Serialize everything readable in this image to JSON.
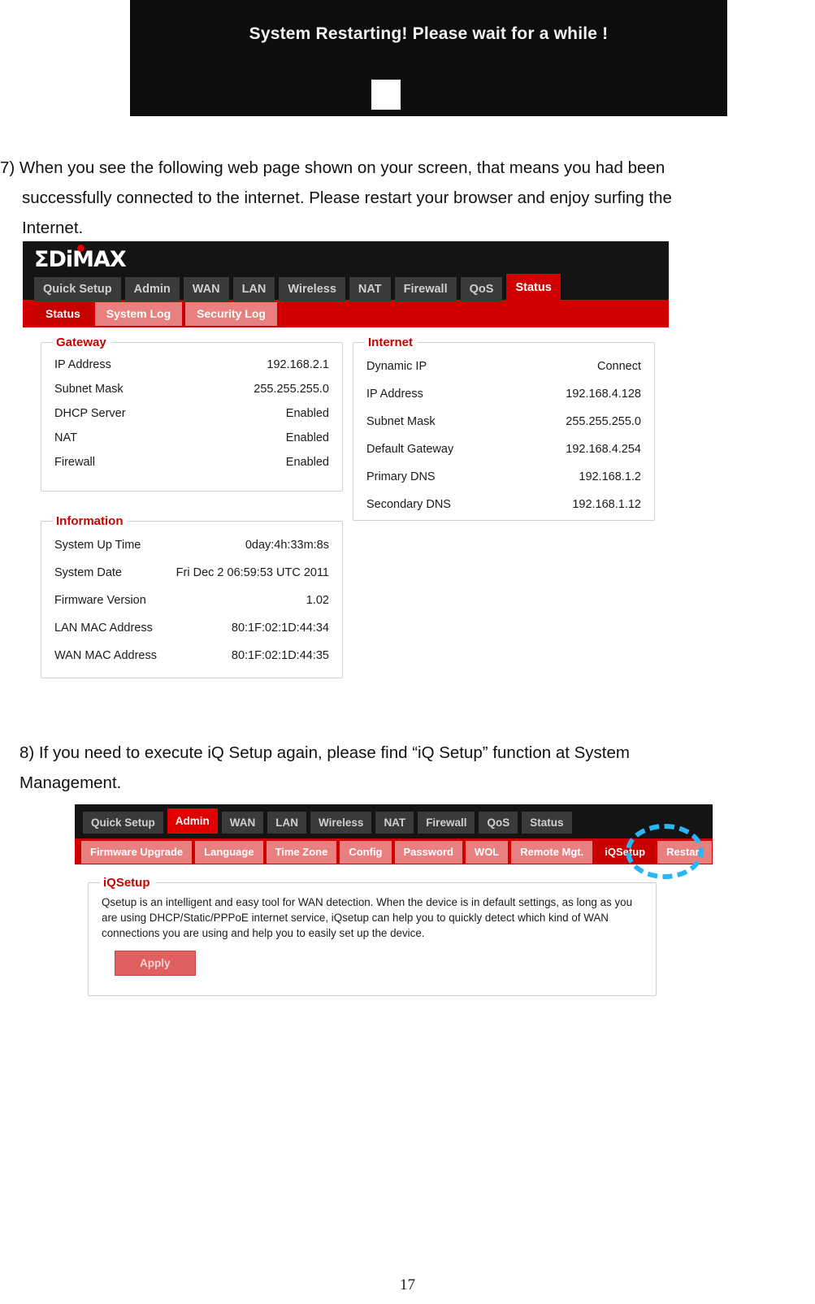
{
  "restart_banner": {
    "message": "System Restarting! Please wait for a while !",
    "progress_label": ""
  },
  "steps": {
    "step7": {
      "number": "7)",
      "line1": "7) When you see the following web page shown on your screen, that means you had been",
      "line2": "successfully connected to the internet. Please restart your browser and enjoy surfing the",
      "line3": "Internet."
    },
    "step8": {
      "line1": "8) If you need to execute iQ Setup again, please find “iQ Setup” function at System",
      "line2": "Management."
    }
  },
  "router_status": {
    "logo": "ΣDiMAX",
    "nav_tabs": [
      {
        "label": "Quick Setup",
        "active": false
      },
      {
        "label": "Admin",
        "active": false
      },
      {
        "label": "WAN",
        "active": false
      },
      {
        "label": "LAN",
        "active": false
      },
      {
        "label": "Wireless",
        "active": false
      },
      {
        "label": "NAT",
        "active": false
      },
      {
        "label": "Firewall",
        "active": false
      },
      {
        "label": "QoS",
        "active": false
      },
      {
        "label": "Status",
        "active": true
      }
    ],
    "sub_tabs": [
      {
        "label": "Status",
        "active": true
      },
      {
        "label": "System Log",
        "active": false
      },
      {
        "label": "Security Log",
        "active": false
      }
    ],
    "panels": {
      "gateway": {
        "title": "Gateway",
        "rows": [
          {
            "key": "IP Address",
            "value": "192.168.2.1"
          },
          {
            "key": "Subnet Mask",
            "value": "255.255.255.0"
          },
          {
            "key": "DHCP Server",
            "value": "Enabled"
          },
          {
            "key": "NAT",
            "value": "Enabled"
          },
          {
            "key": "Firewall",
            "value": "Enabled"
          }
        ]
      },
      "internet": {
        "title": "Internet",
        "rows": [
          {
            "key": "Dynamic IP",
            "value": "Connect"
          },
          {
            "key": "IP Address",
            "value": "192.168.4.128"
          },
          {
            "key": "Subnet Mask",
            "value": "255.255.255.0"
          },
          {
            "key": "Default Gateway",
            "value": "192.168.4.254"
          },
          {
            "key": "Primary DNS",
            "value": "192.168.1.2"
          },
          {
            "key": "Secondary DNS",
            "value": "192.168.1.12"
          }
        ]
      },
      "information": {
        "title": "Information",
        "rows": [
          {
            "key": "System Up Time",
            "value": "0day:4h:33m:8s"
          },
          {
            "key": "System Date",
            "value": "Fri Dec 2 06:59:53 UTC 2011"
          },
          {
            "key": "Firmware Version",
            "value": "1.02"
          },
          {
            "key": "LAN MAC Address",
            "value": "80:1F:02:1D:44:34"
          },
          {
            "key": "WAN MAC Address",
            "value": "80:1F:02:1D:44:35"
          }
        ]
      }
    }
  },
  "router_admin": {
    "nav_tabs": [
      {
        "label": "Quick Setup",
        "active": false
      },
      {
        "label": "Admin",
        "active": true
      },
      {
        "label": "WAN",
        "active": false
      },
      {
        "label": "LAN",
        "active": false
      },
      {
        "label": "Wireless",
        "active": false
      },
      {
        "label": "NAT",
        "active": false
      },
      {
        "label": "Firewall",
        "active": false
      },
      {
        "label": "QoS",
        "active": false
      },
      {
        "label": "Status",
        "active": false
      }
    ],
    "sub_tabs": [
      {
        "label": "Firmware Upgrade",
        "active": false
      },
      {
        "label": "Language",
        "active": false
      },
      {
        "label": "Time Zone",
        "active": false
      },
      {
        "label": "Config",
        "active": false
      },
      {
        "label": "Password",
        "active": false
      },
      {
        "label": "WOL",
        "active": false
      },
      {
        "label": "Remote Mgt.",
        "active": false
      },
      {
        "label": "iQSetup",
        "active": true
      },
      {
        "label": "Restart",
        "active": false
      }
    ],
    "iqsetup": {
      "title": "iQSetup",
      "description": "Qsetup is an intelligent and easy tool for WAN detection. When the device is in default settings, as long as you are using DHCP/Static/PPPoE internet service, iQsetup can help you to quickly detect which kind of WAN connections you are using and help you to easily set up the device.",
      "apply_label": "Apply"
    },
    "highlight_color": "#29b6f6"
  },
  "page": {
    "number": "17"
  },
  "colors": {
    "brand_red": "#d10000",
    "nav_dark": "#141414",
    "tab_grey": "#3a3a3a",
    "subtab_light_red": "#e88080",
    "legend_red": "#cc0000",
    "highlight_cyan": "#29b6f6"
  }
}
